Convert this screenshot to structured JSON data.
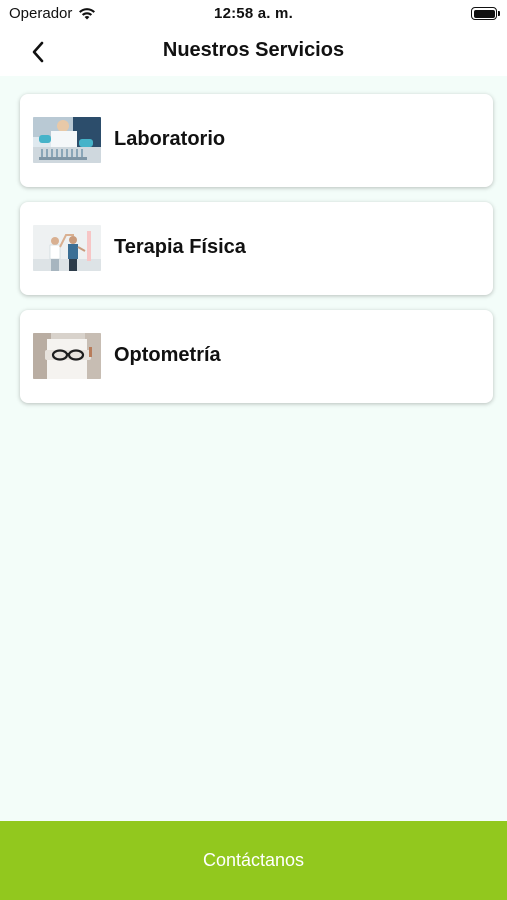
{
  "status_bar": {
    "carrier": "Operador",
    "time": "12:58 a. m.",
    "battery_level": 1.0
  },
  "nav": {
    "title": "Nuestros Servicios",
    "back_icon": "chevron-left-icon"
  },
  "services": [
    {
      "label": "Laboratorio",
      "image": "laboratory-photo"
    },
    {
      "label": "Terapia Física",
      "image": "physical-therapy-photo"
    },
    {
      "label": "Optometría",
      "image": "optometry-photo"
    }
  ],
  "footer": {
    "contact_label": "Contáctanos"
  },
  "colors": {
    "background": "#f3fdf9",
    "accent": "#92c81e",
    "card": "#ffffff"
  }
}
